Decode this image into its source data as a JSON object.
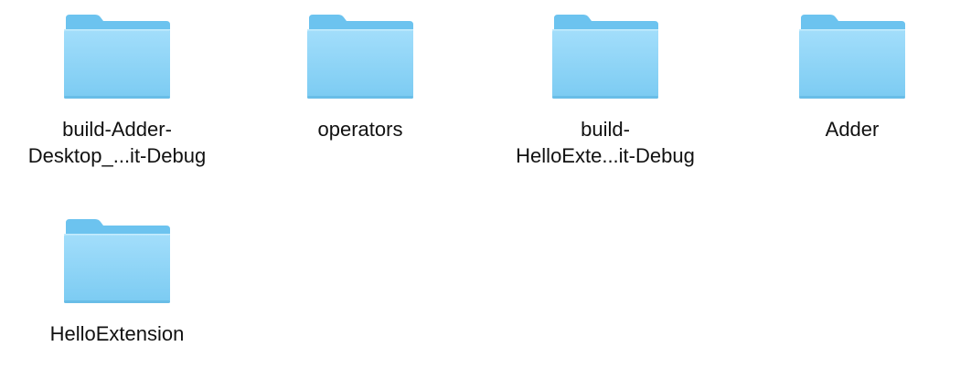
{
  "finder": {
    "items": [
      {
        "kind": "folder",
        "icon": "folder-icon",
        "label_lines": [
          "build-Adder-",
          "Desktop_...it-Debug"
        ]
      },
      {
        "kind": "folder",
        "icon": "folder-icon",
        "label_lines": [
          "operators"
        ]
      },
      {
        "kind": "folder",
        "icon": "folder-icon",
        "label_lines": [
          "build-",
          "HelloExte...it-Debug"
        ]
      },
      {
        "kind": "folder",
        "icon": "folder-icon",
        "label_lines": [
          "Adder"
        ]
      },
      {
        "kind": "folder",
        "icon": "folder-icon",
        "label_lines": [
          "HelloExtension"
        ]
      }
    ]
  },
  "colors": {
    "background": "#ffffff",
    "folder_back": "#6cc3ef",
    "folder_front_top": "#9fdcfa",
    "folder_front_bottom": "#7ccdf3",
    "label_text": "#111111"
  }
}
